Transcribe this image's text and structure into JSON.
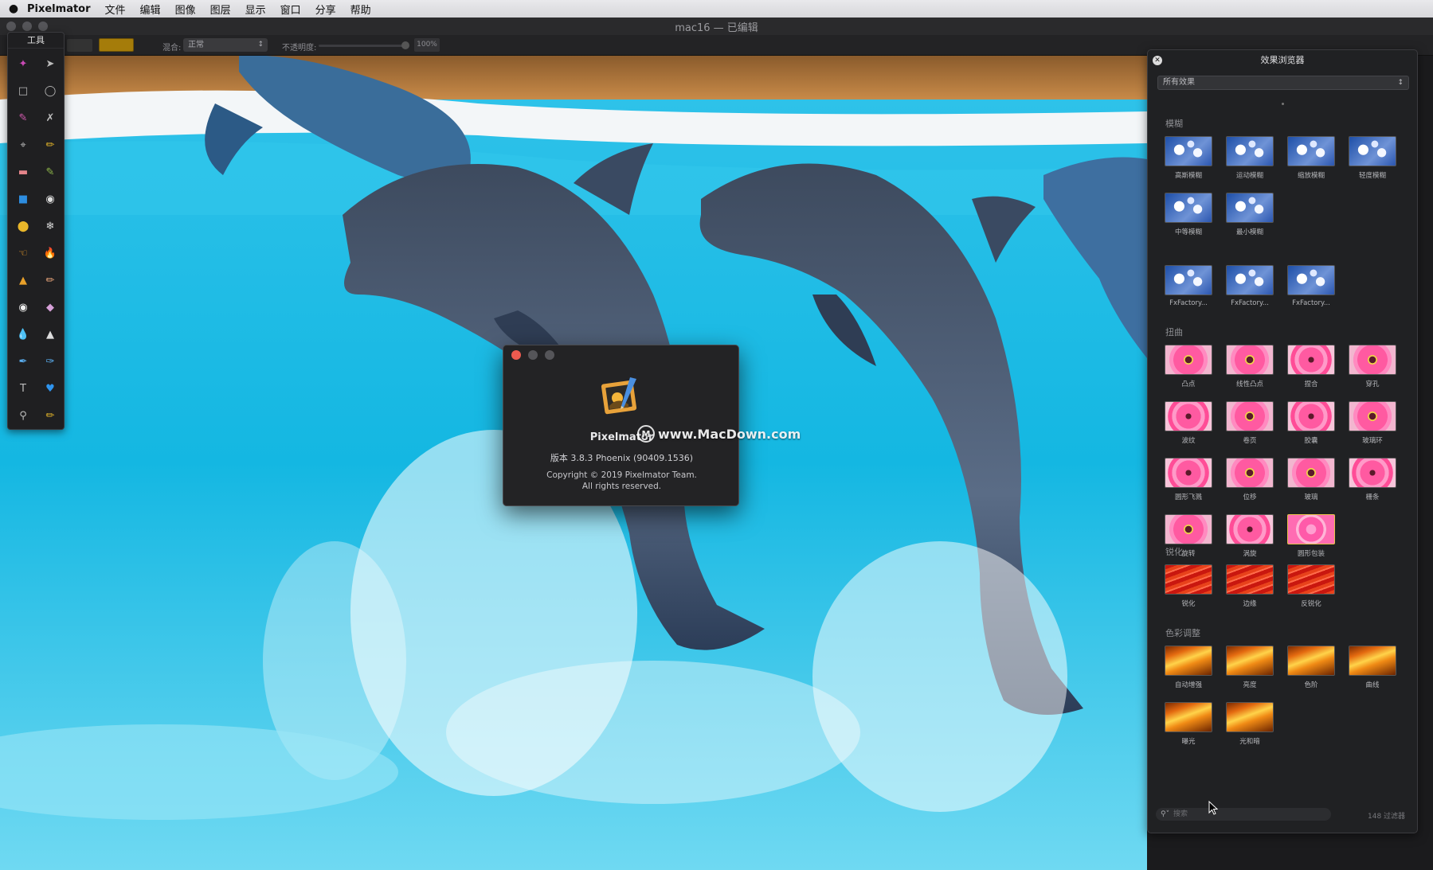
{
  "menubar": {
    "apple": "",
    "app_name": "Pixelmator",
    "items": [
      "文件",
      "编辑",
      "图像",
      "图层",
      "显示",
      "窗口",
      "分享",
      "帮助"
    ]
  },
  "window": {
    "title": "mac16 — 已编辑"
  },
  "options_bar": {
    "blend_label": "混合:",
    "blend_value": "正常",
    "opacity_label": "不透明度:",
    "opacity_value": "100%",
    "swatch_color": "#a57c0a"
  },
  "tools_palette": {
    "title": "工具",
    "tools": [
      "magic-wand",
      "pointer",
      "rect-select",
      "ellipse-select",
      "brush-select",
      "lasso",
      "crop",
      "eyedropper",
      "eraser",
      "paint-brush",
      "rectangle",
      "paint-bucket",
      "ellipse",
      "spray",
      "smudge",
      "burn",
      "stamp",
      "pencil",
      "red-eye",
      "sponge",
      "drop",
      "sharpen",
      "pen",
      "freeform-pen",
      "text",
      "shape",
      "zoom",
      "eyedropper-2"
    ]
  },
  "about": {
    "app_name": "Pixelmator",
    "version": "版本 3.8.3 Phoenix (90409.1536)",
    "copyright_1": "Copyright © 2019 Pixelmator Team.",
    "copyright_2": "All rights reserved."
  },
  "watermark": {
    "text": "www.MacDown.com"
  },
  "effects": {
    "title": "效果浏览器",
    "filter_select": "所有效果",
    "categories": [
      {
        "name": "模糊",
        "items": [
          "高斯模糊",
          "运动模糊",
          "缩放模糊",
          "轻度模糊",
          "中等模糊",
          "最小模糊"
        ]
      },
      {
        "name": "",
        "items": [
          "FxFactory...",
          "FxFactory...",
          "FxFactory..."
        ]
      },
      {
        "name": "扭曲",
        "items": [
          "凸点",
          "线性凸点",
          "捏合",
          "穿孔",
          "波纹",
          "卷页",
          "胶囊",
          "玻璃环",
          "圆形飞溅",
          "位移",
          "玻璃",
          "栅条",
          "旋转",
          "涡旋",
          "圆形包装"
        ]
      },
      {
        "name": "锐化",
        "items": [
          "锐化",
          "边缘",
          "反锐化"
        ]
      },
      {
        "name": "色彩调整",
        "items": [
          "自动增强",
          "亮度",
          "色阶",
          "曲线",
          "曝光",
          "光和暗"
        ]
      }
    ],
    "search_placeholder": "搜索",
    "count": "148 过滤器"
  }
}
